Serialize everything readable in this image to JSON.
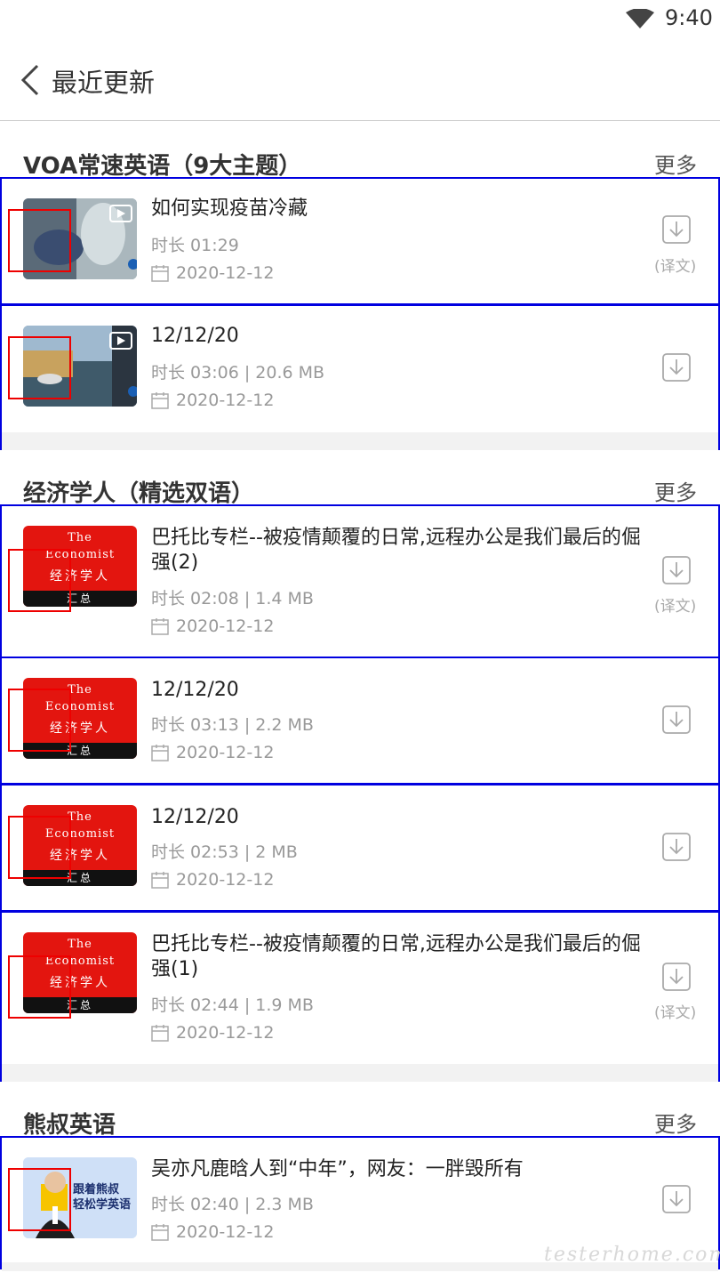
{
  "status": {
    "time": "9:40",
    "wifi_icon": "wifi-icon"
  },
  "app_bar": {
    "title": "最近更新",
    "back_icon": "chevron-left-icon"
  },
  "sections": [
    {
      "title": "VOA常速英语（9大主题）",
      "more": "更多",
      "items": [
        {
          "title": "如何实现疫苗冷藏",
          "meta": "时长 01:29",
          "date": "2020-12-12",
          "download_label": "(译文)"
        },
        {
          "title": "12/12/20",
          "meta": "时长 03:06 |  20.6 MB",
          "date": "2020-12-12",
          "download_label": ""
        }
      ]
    },
    {
      "title": "经济学人（精选双语）",
      "more": "更多",
      "items": [
        {
          "title": "巴托比专栏--被疫情颠覆的日常,远程办公是我们最后的倔强(2)",
          "meta": "时长 02:08 |  1.4 MB",
          "date": "2020-12-12",
          "download_label": "(译文)"
        },
        {
          "title": "12/12/20",
          "meta": "时长 03:13 |  2.2 MB",
          "date": "2020-12-12",
          "download_label": ""
        },
        {
          "title": "12/12/20",
          "meta": "时长 02:53 |  2 MB",
          "date": "2020-12-12",
          "download_label": ""
        },
        {
          "title": "巴托比专栏--被疫情颠覆的日常,远程办公是我们最后的倔强(1)",
          "meta": "时长 02:44 |  1.9 MB",
          "date": "2020-12-12",
          "download_label": "(译文)"
        }
      ]
    },
    {
      "title": "熊叔英语",
      "more": "更多",
      "items": [
        {
          "title": "吴亦凡鹿晗人到“中年”，网友：一胖毁所有",
          "meta": "时长 02:40 |  2.3 MB",
          "date": "2020-12-12",
          "download_label": ""
        }
      ]
    }
  ],
  "thumb_text": {
    "economist": {
      "line1": "The",
      "line2": "Economist",
      "line3": "经济学人",
      "line4": "汇总"
    },
    "xiongshu": {
      "line1": "跟着熊叔",
      "line2": "轻松学英语"
    }
  },
  "watermark": "testerhome.com",
  "colors": {
    "highlight_border": "#0000e0",
    "marker_box": "#ee0000",
    "economist_red": "#e3150f"
  }
}
